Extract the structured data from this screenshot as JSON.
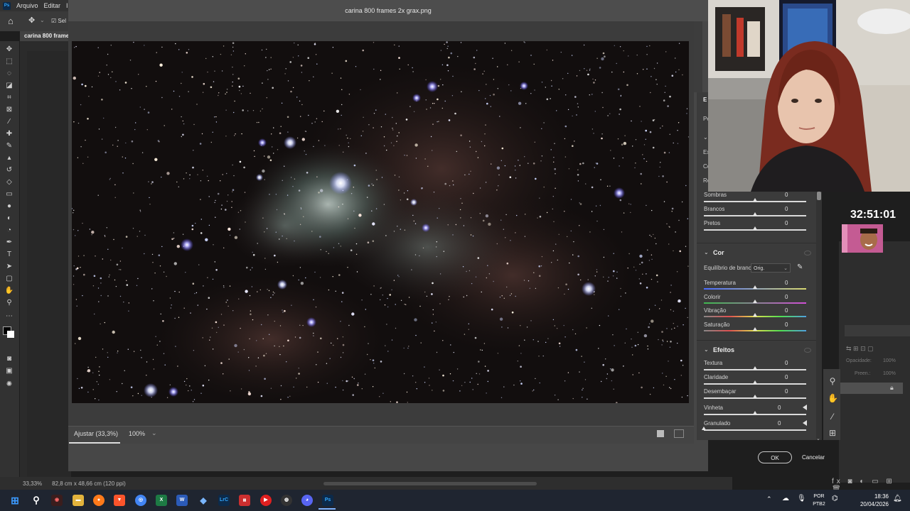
{
  "photoshop": {
    "menu": [
      "Arquivo",
      "Editar",
      "Im"
    ],
    "doc_tab": "carina 800 frames",
    "options_label": "Sel",
    "status_zoom": "33,33%",
    "status_dims": "82,8 cm x 48,66 cm (120 ppi)",
    "right_panel_labels": {
      "opacity": "Opacidade:",
      "opacity_val": "100%",
      "fill": "Preen.:",
      "fill_val": "100%"
    }
  },
  "dialog": {
    "title": "carina 800 frames 2x grax.png",
    "zoom_fit_label": "Ajustar (33,3%)",
    "zoom_100": "100%",
    "ok": "OK",
    "cancel": "Cancelar"
  },
  "panel": {
    "partial_labels": [
      "E",
      "Pe",
      "Ex",
      "Co",
      "Re"
    ],
    "basic_rest": [
      {
        "label": "Sombras",
        "value": "0"
      },
      {
        "label": "Brancos",
        "value": "0"
      },
      {
        "label": "Pretos",
        "value": "0"
      }
    ],
    "color": {
      "title": "Cor",
      "wb_label": "Equilíbrio de branco",
      "wb_value": "Orig.",
      "sliders": [
        {
          "label": "Temperatura",
          "value": "0"
        },
        {
          "label": "Colorir",
          "value": "0"
        },
        {
          "label": "Vibração",
          "value": "0"
        },
        {
          "label": "Saturação",
          "value": "0"
        }
      ]
    },
    "effects": {
      "title": "Efeitos",
      "sliders": [
        {
          "label": "Textura",
          "value": "0"
        },
        {
          "label": "Claridade",
          "value": "0"
        },
        {
          "label": "Desembaçar",
          "value": "0"
        },
        {
          "label": "Vinheta",
          "value": "0"
        },
        {
          "label": "Granulado",
          "value": "0"
        }
      ]
    }
  },
  "overlay": {
    "timer": "32:51:01"
  },
  "taskbar": {
    "lang_line1": "POR",
    "lang_line2": "PTB2",
    "time": "18:36",
    "date": "20/04/2026",
    "icons": [
      "start",
      "search",
      "game",
      "files",
      "firefox",
      "brave",
      "chrome",
      "excel",
      "word",
      "app",
      "lrc",
      "other",
      "play",
      "obs",
      "discord",
      "photoshop"
    ],
    "lrc_label": "LrC",
    "ps_label": "Ps",
    "word_label": "W",
    "excel_label": "X"
  },
  "colors": {
    "accent": "#31a8ff",
    "dialog_bg": "#474747",
    "panel_bg": "#3b3b3b"
  }
}
